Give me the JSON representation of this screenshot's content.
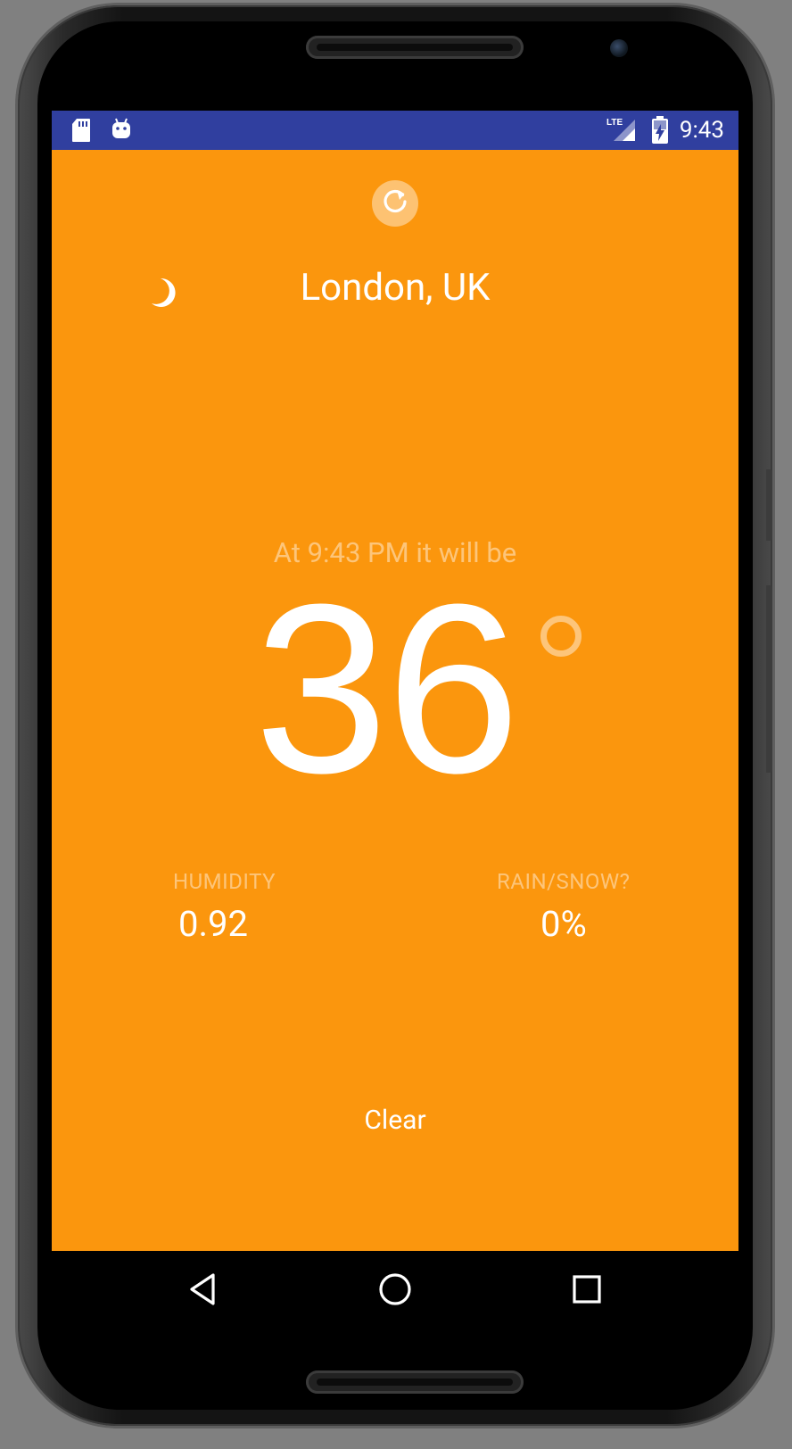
{
  "status_bar": {
    "time": "9:43",
    "network": "LTE",
    "icons": [
      "sd-card-icon",
      "android-debug-icon",
      "lte-signal-icon",
      "battery-charging-icon"
    ],
    "color": "#303f9f"
  },
  "weather": {
    "location": "London, UK",
    "time_label": "At 9:43 PM it will be",
    "temperature": "36",
    "humidity_label": "HUMIDITY",
    "humidity_value": "0.92",
    "precip_label": "RAIN/SNOW?",
    "precip_value": "0%",
    "summary": "Clear",
    "condition_icon": "moon-icon",
    "background_color": "#fb960d"
  },
  "navigation": {
    "buttons": [
      "back-icon",
      "home-icon",
      "recents-icon"
    ]
  }
}
